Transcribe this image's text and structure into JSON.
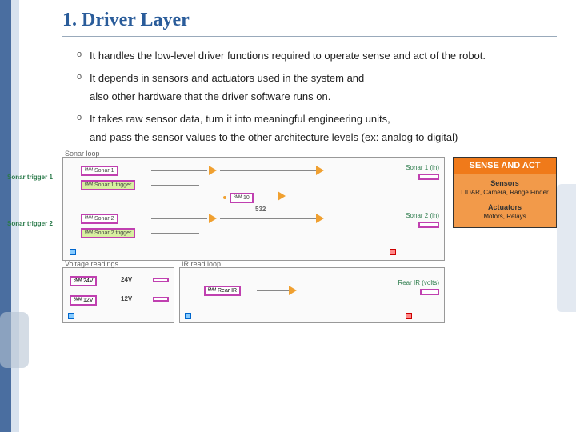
{
  "title": "1. Driver Layer",
  "bullets": {
    "b1": "It handles the low-level driver functions required to operate sense and act of the robot.",
    "b2": "It depends in sensors and actuators used in the system and",
    "b2c": "also other hardware that the driver software runs on.",
    "b3": "It takes raw sensor data, turn it into meaningful engineering units,",
    "b3c": "and pass the sensor values to the other architecture levels (ex: analog  to digital)"
  },
  "diagram": {
    "sonar_label": "Sonar loop",
    "sig1": "Sonar trigger 1",
    "sig2": "Sonar trigger 2",
    "node_s1": "ᴮᴹᴹ Sonar 1",
    "node_t1": "ᴮᴹᴹ Sonar 1 trigger",
    "node_s2": "ᴮᴹᴹ Sonar 2",
    "node_t2": "ᴮᴹᴹ Sonar 2 trigger",
    "mid_node": "ᴮᴹᴹ   10",
    "mid_tag": "532",
    "out1": "Sonar 1 (in)",
    "out2": "Sonar 2 (in)",
    "volt_label": "Voltage readings",
    "v1": "ᴮᴹᴹ 24V",
    "v1r": "24V",
    "v2": "ᴮᴹᴹ 12V",
    "v2r": "12V",
    "ir_label": "IR read loop",
    "ir_node": "ᴮᴹᴹ Rear IR",
    "ir_out": "Rear IR (volts)"
  },
  "sense": {
    "header": "SENSE AND ACT",
    "sensors_title": "Sensors",
    "sensors_items": "LIDAR, Camera, Range Finder",
    "actuators_title": "Actuators",
    "actuators_items": "Motors, Relays"
  }
}
